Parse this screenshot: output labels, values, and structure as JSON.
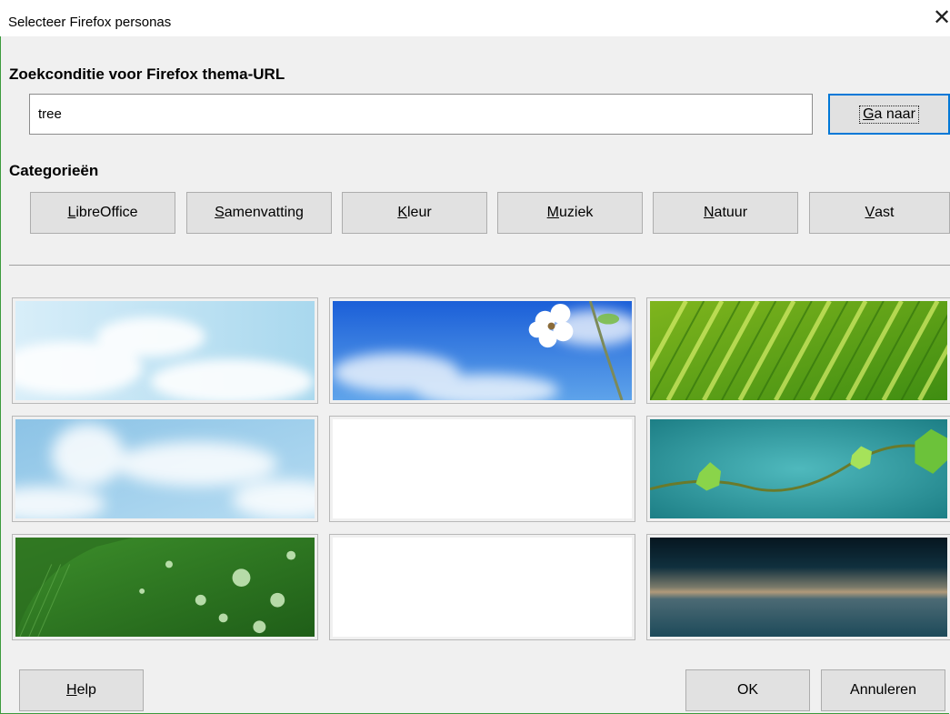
{
  "window": {
    "title": "Selecteer Firefox personas",
    "close_glyph": "✕"
  },
  "search": {
    "label": "Zoekconditie voor Firefox thema-URL",
    "value": "tree",
    "go_button": {
      "mnemonic": "G",
      "rest": "a naar"
    }
  },
  "categories": {
    "label": "Categorieën",
    "buttons": [
      {
        "mnemonic": "L",
        "rest": "ibreOffice"
      },
      {
        "mnemonic": "S",
        "rest": "amenvatting"
      },
      {
        "mnemonic": "K",
        "rest": "leur"
      },
      {
        "mnemonic": "M",
        "rest": "uziek"
      },
      {
        "mnemonic": "N",
        "rest": "atuur"
      },
      {
        "mnemonic": "V",
        "rest": "ast"
      }
    ]
  },
  "personas": [
    {
      "theme": "light-clouds"
    },
    {
      "theme": "blue-sky-blossom"
    },
    {
      "theme": "green-palm-leaf"
    },
    {
      "theme": "soft-clouds"
    },
    {
      "theme": "empty"
    },
    {
      "theme": "teal-vine-leaves"
    },
    {
      "theme": "green-water-drops"
    },
    {
      "theme": "empty"
    },
    {
      "theme": "dark-horizon"
    }
  ],
  "footer": {
    "help_button": {
      "mnemonic": "H",
      "rest": "elp"
    },
    "ok_button": "OK",
    "cancel_button": "Annuleren"
  },
  "colors": {
    "window_border": "#3c9a3c",
    "focus_blue": "#0078d7",
    "dialog_bg": "#f0f0f0"
  }
}
